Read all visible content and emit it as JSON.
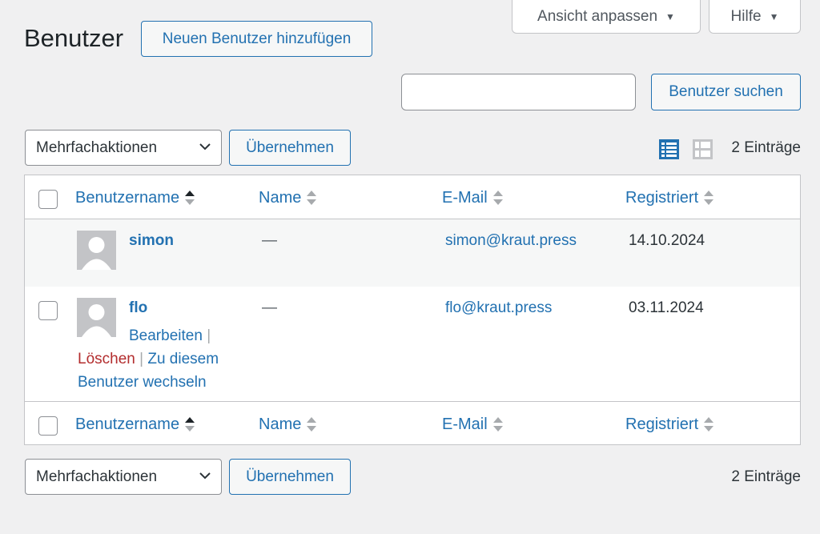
{
  "screen_options": {
    "label": "Ansicht anpassen"
  },
  "help": {
    "label": "Hilfe"
  },
  "page": {
    "title": "Benutzer",
    "add_new": "Neuen Benutzer hinzufügen"
  },
  "search": {
    "value": "",
    "button": "Benutzer suchen"
  },
  "bulk": {
    "selected": "Mehrfachaktionen",
    "apply": "Übernehmen"
  },
  "count": "2 Einträge",
  "columns": {
    "username": "Benutzername",
    "name": "Name",
    "email": "E-Mail",
    "registered": "Registriert"
  },
  "rows": [
    {
      "username": "simon",
      "name": "—",
      "email": "simon@kraut.press",
      "registered": "14.10.2024"
    },
    {
      "username": "flo",
      "name": "—",
      "email": "flo@kraut.press",
      "registered": "03.11.2024"
    }
  ],
  "row_actions": {
    "edit": "Bearbeiten",
    "delete": "Löschen",
    "switch_1": "Zu diesem",
    "switch_2": "Benutzer wechseln",
    "separator": "|"
  },
  "colors": {
    "link": "#2271b1",
    "delete": "#b32d2e",
    "background": "#f0f0f1"
  },
  "icons": [
    "caret-down-icon",
    "chevron-down-icon",
    "list-view-icon",
    "excerpt-view-icon",
    "sort-icon",
    "avatar-icon"
  ]
}
